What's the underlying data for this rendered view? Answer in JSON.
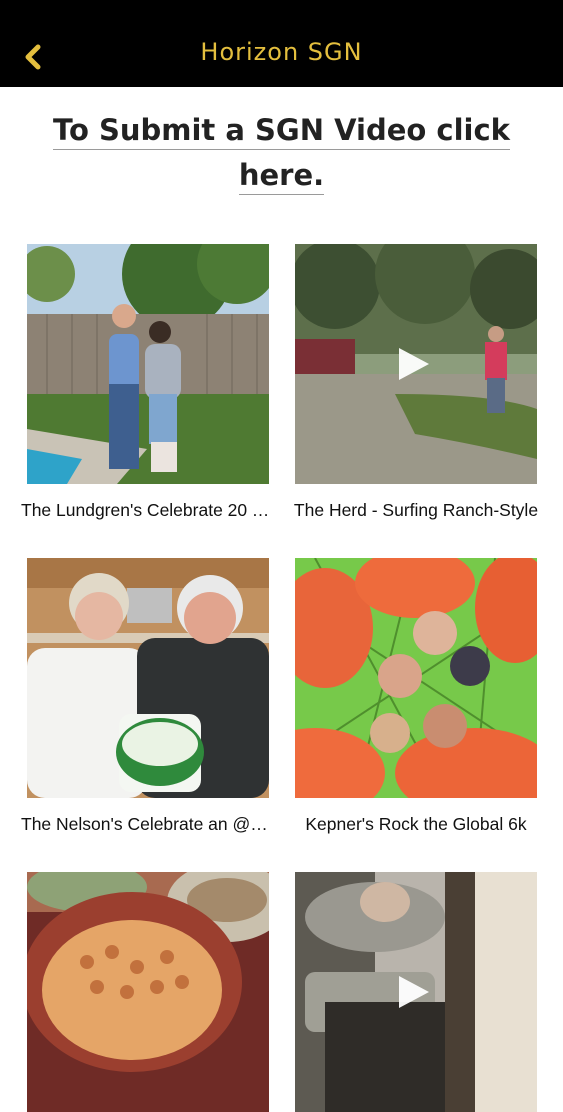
{
  "header": {
    "title": "Horizon SGN",
    "back_icon": "chevron-left-icon",
    "accent_color": "#e4bf3e"
  },
  "submit_link": {
    "line1": "To Submit a SGN Video click",
    "line2": "here."
  },
  "videos": [
    {
      "caption": "The Lundgren's Celebrate 20 Year...",
      "has_play": false
    },
    {
      "caption": "The Herd - Surfing Ranch-Style",
      "has_play": true
    },
    {
      "caption": "The Nelson's Celebrate an @Hom...",
      "has_play": false
    },
    {
      "caption": "Kepner's Rock the Global 6k",
      "has_play": false
    },
    {
      "caption": "",
      "has_play": false
    },
    {
      "caption": "",
      "has_play": true
    }
  ]
}
